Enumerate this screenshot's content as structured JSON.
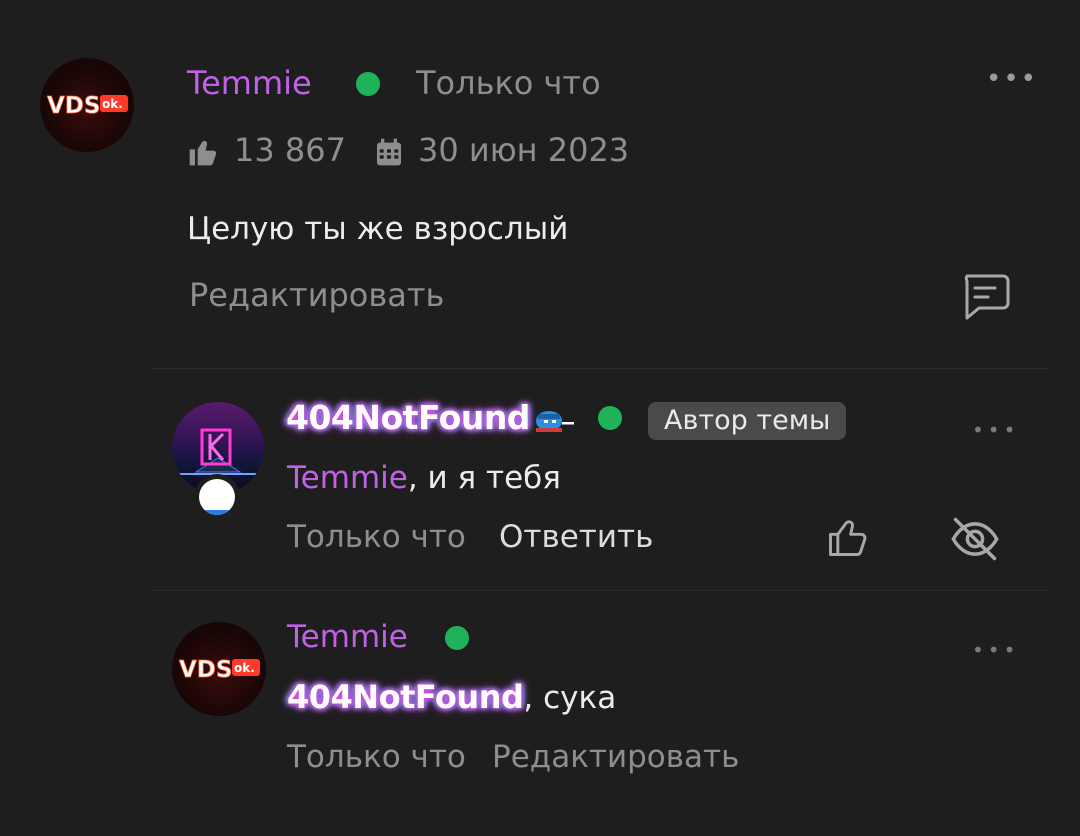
{
  "post": {
    "author": "Temmie",
    "time": "Только что",
    "likes": "13 867",
    "date": "30 июн 2023",
    "body": "Целую ты же взрослый",
    "edit_label": "Редактировать",
    "more": "•••",
    "avatar_text": "VDS",
    "avatar_badge": "ok."
  },
  "reply1": {
    "author": "404NotFound",
    "badge": "Автор темы",
    "mention": "Temmie",
    "text": ", и я тебя",
    "time": "Только что",
    "reply_label": "Ответить",
    "more": "•••"
  },
  "reply2": {
    "author": "Temmie",
    "mention": "404NotFound",
    "text": ", сука",
    "time": "Только что",
    "edit_label": "Редактировать",
    "more": "•••",
    "avatar_text": "VDS",
    "avatar_badge": "ok."
  },
  "colors": {
    "background": "#1e1e1f",
    "username": "#c061e6",
    "online": "#1fb25a"
  }
}
